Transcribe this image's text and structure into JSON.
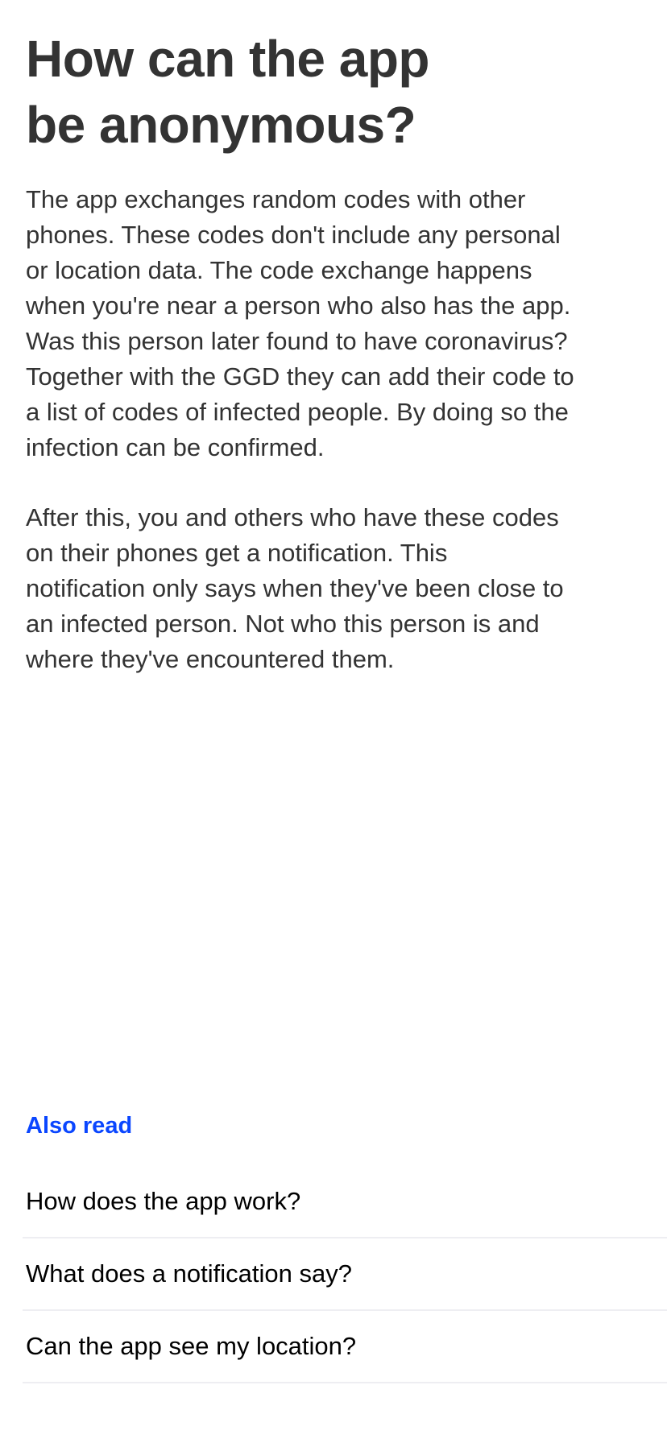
{
  "title_lines": [
    "How can the app",
    "be anonymous?"
  ],
  "paragraph1_lines": [
    "The app exchanges random codes with other",
    "phones. These codes don't include any personal",
    "or location data. The code exchange happens",
    "when you're near a person who also has the app.",
    "Was this person later found to have coronavirus?",
    "Together with the GGD they can add their code to",
    "a list of codes of infected people. By doing so the",
    "infection can be confirmed."
  ],
  "paragraph2_lines": [
    "After this, you and others who have these codes",
    "on their phones get a notification. This",
    "notification only says when they've been close to",
    "an infected person. Not who this person is and",
    "where they've encountered them."
  ],
  "also_read": {
    "heading": "Also read",
    "items": [
      "How does the app work?",
      "What does a notification say?",
      "Can the app see my location?"
    ]
  },
  "colors": {
    "accent": "#0a46ff",
    "text": "#333333",
    "separator": "#eeeef2"
  }
}
